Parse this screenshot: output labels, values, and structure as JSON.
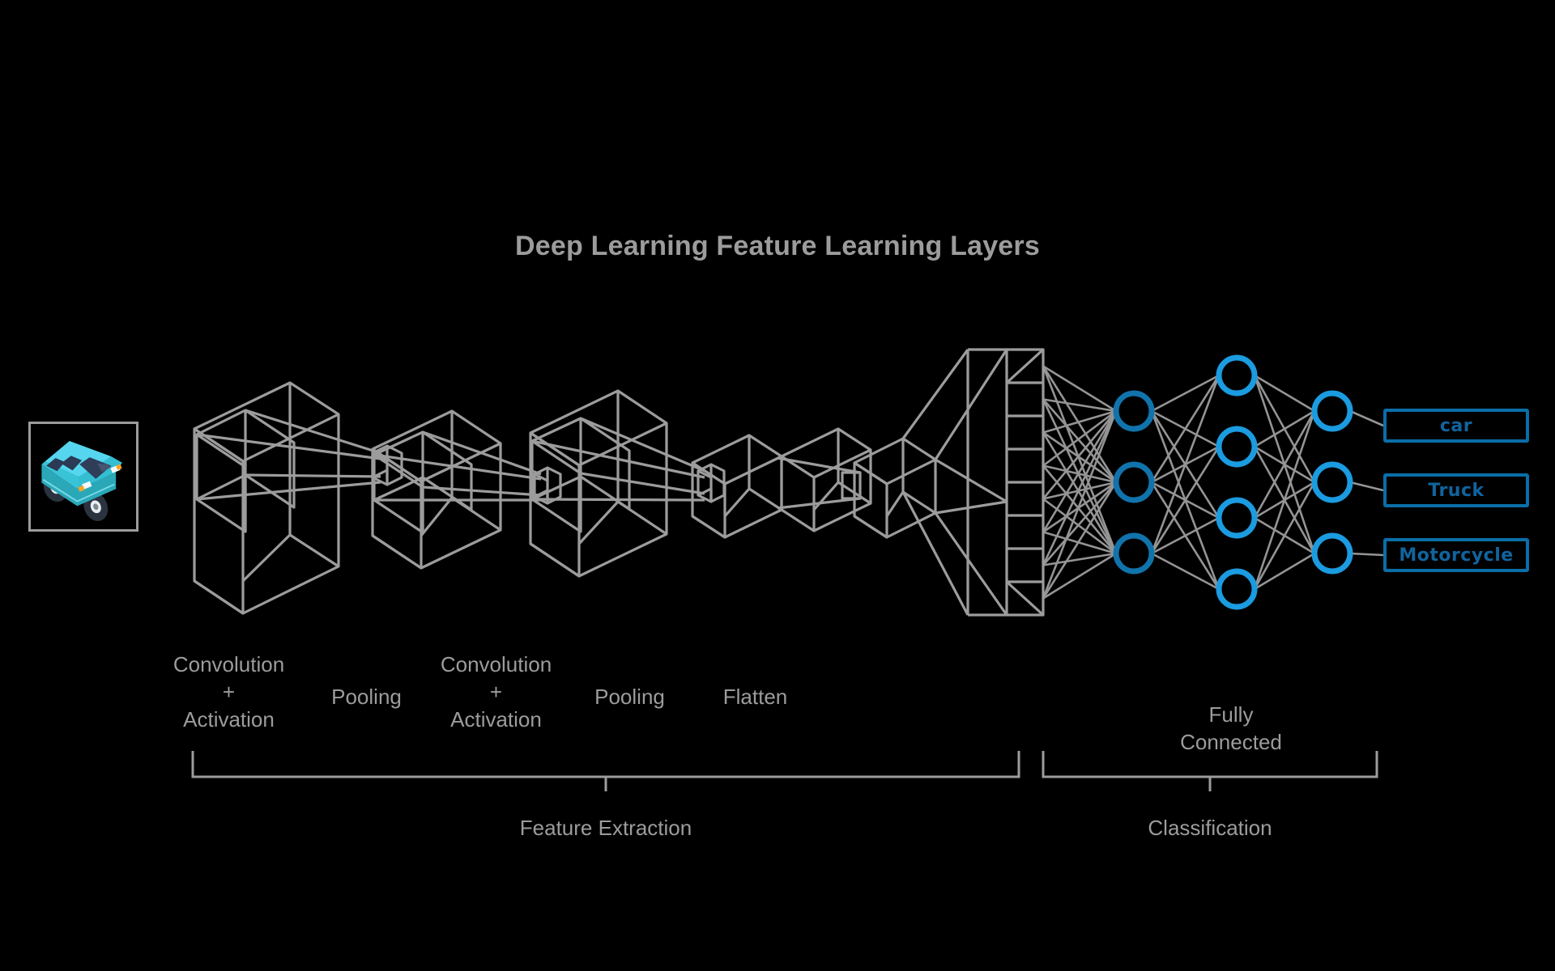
{
  "title": "Deep Learning Feature Learning Layers",
  "colors": {
    "background": "#000000",
    "wireframe_gray": "#9c9c9c",
    "text_gray": "#9c9c9c",
    "neuron_blue": "#1b9be0",
    "neuron_blue_dark": "#1173ab",
    "output_box_border": "#0a6ea8",
    "output_box_text": "#10649e",
    "car_body": "#2fc4d8",
    "car_roof": "#4fd4ef",
    "car_window": "#28364f",
    "car_tire": "#2b3340",
    "car_light": "#f5a623"
  },
  "input": {
    "name": "input-image",
    "subject": "car"
  },
  "stage_labels": [
    {
      "id": "conv1",
      "text": "Convolution\n+\nActivation"
    },
    {
      "id": "pool1",
      "text": "Pooling"
    },
    {
      "id": "conv2",
      "text": "Convolution\n+\nActivation"
    },
    {
      "id": "pool2",
      "text": "Pooling"
    },
    {
      "id": "flatten",
      "text": "Flatten"
    },
    {
      "id": "fc",
      "text": "Fully\nConnected"
    }
  ],
  "outputs": [
    {
      "id": "car",
      "label": "car"
    },
    {
      "id": "truck",
      "label": "Truck"
    },
    {
      "id": "motorcycle",
      "label": "Motorcycle"
    }
  ],
  "brackets": [
    {
      "id": "feature-extraction",
      "label": "Feature Extraction"
    },
    {
      "id": "classification",
      "label": "Classification"
    }
  ],
  "network": {
    "hidden1_nodes": 3,
    "hidden2_nodes": 4,
    "output_nodes": 3,
    "flatten_cells": 8
  }
}
